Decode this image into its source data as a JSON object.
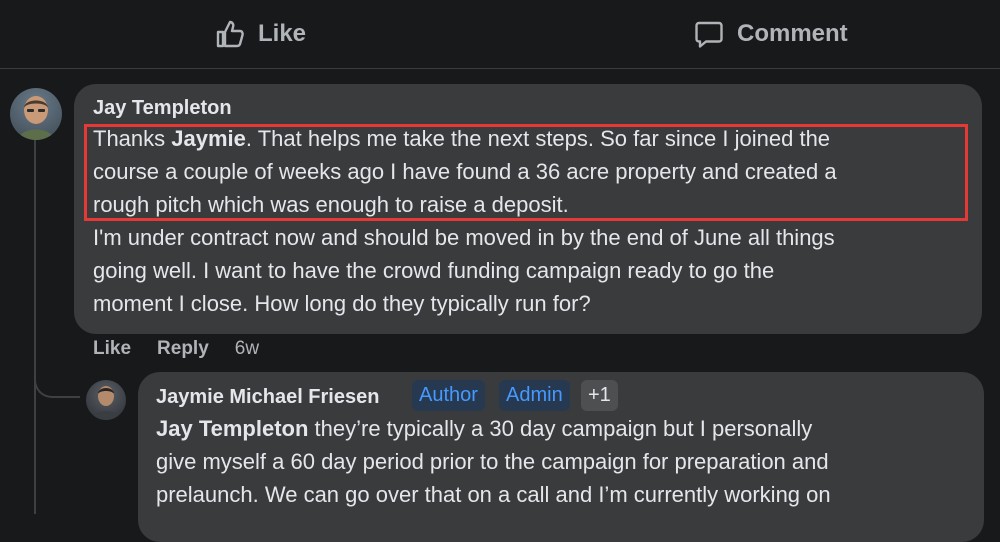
{
  "actions": {
    "like_label": "Like",
    "comment_label": "Comment",
    "like_icon": "thumbs-up-icon",
    "comment_icon": "speech-bubble-icon"
  },
  "comment_jay": {
    "author": "Jay Templeton",
    "line1_pre": "Thanks ",
    "line1_mention": "Jaymie",
    "line1_post": ". That helps me take the next steps. So far since I joined the",
    "line2": "course a couple of weeks ago I have found a 36 acre property and created a",
    "line3": "rough pitch which was enough to raise a deposit.",
    "line4": "I'm under contract now and should be moved in by the end of June all things",
    "line5": "going well. I want to have the crowd funding campaign ready to go the",
    "line6": "moment I close. How long do they typically run for?",
    "like_label": "Like",
    "reply_label": "Reply",
    "time": "6w"
  },
  "comment_jaymie": {
    "author": "Jaymie Michael Friesen",
    "badge_author": "Author",
    "badge_admin": "Admin",
    "badge_more": "+1",
    "line1_mention": "Jay Templeton",
    "line1_post": " they’re typically a 30 day campaign but I personally",
    "line2": "give myself a 60 day period prior to the campaign for preparation and",
    "line3": "prelaunch. We can go over that on a call and I’m currently working on"
  },
  "colors": {
    "background": "#18191a",
    "bubble": "#3a3b3c",
    "highlight": "#e53935",
    "badge_text": "#4599ff"
  }
}
